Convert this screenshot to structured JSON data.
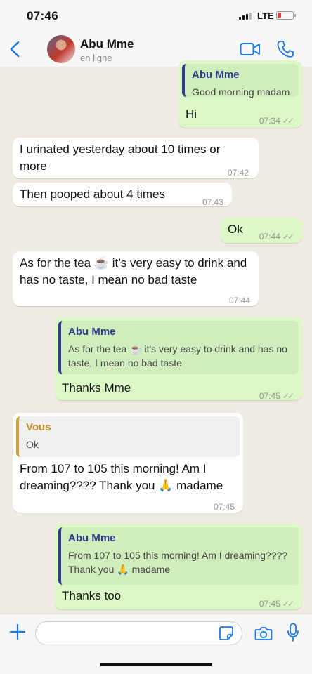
{
  "status_bar": {
    "time": "07:46",
    "network": "LTE",
    "battery_level": 0.2
  },
  "header": {
    "contact_name": "Abu Mme",
    "contact_status": "en ligne",
    "icons": {
      "back": "chevron-left-icon",
      "video": "video-camera-icon",
      "call": "phone-icon"
    }
  },
  "messages": [
    {
      "type": "outgoing",
      "quote_author": "Abu Mme",
      "quote_text": "Good morning madam",
      "text": "Hi",
      "time": "07:34",
      "ticks": "✓✓"
    },
    {
      "type": "incoming",
      "text": "I urinated yesterday about 10 times or more",
      "time": "07:42"
    },
    {
      "type": "incoming",
      "text": "Then pooped about 4 times",
      "time": "07:43"
    },
    {
      "type": "outgoing",
      "text": "Ok",
      "time": "07:44",
      "ticks": "✓✓"
    },
    {
      "type": "incoming",
      "text": "As for the tea ☕ it’s very easy to drink and has no taste, I mean no bad taste",
      "time": "07:44"
    },
    {
      "type": "outgoing",
      "quote_author": "Abu Mme",
      "quote_text": "As for the tea ☕ it's very easy to drink and has no taste, I mean no bad taste",
      "text": "Thanks Mme",
      "time": "07:45",
      "ticks": "✓✓"
    },
    {
      "type": "incoming",
      "quote_author": "Vous",
      "quote_text": "Ok",
      "text": "From 107 to 105 this morning! Am I dreaming???? Thank you 🙏 madame",
      "time": "07:45"
    },
    {
      "type": "outgoing",
      "quote_author": "Abu Mme",
      "quote_text": "From 107 to 105 this morning! Am I dreaming???? Thank you 🙏 madame",
      "text": "Thanks too",
      "time": "07:45",
      "ticks": "✓✓"
    }
  ],
  "input_bar": {
    "placeholder": "",
    "icons": {
      "attach": "plus-icon",
      "sticker": "sticker-icon",
      "camera": "camera-icon",
      "mic": "microphone-icon"
    }
  },
  "colors": {
    "accent": "#1c7ae8",
    "outgoing_bubble": "#dcf8c6",
    "incoming_bubble": "#ffffff",
    "background": "#efeae2"
  }
}
